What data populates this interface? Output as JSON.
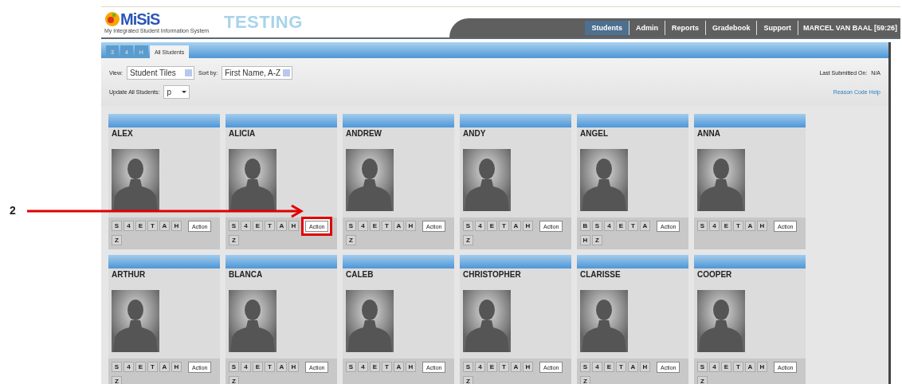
{
  "header": {
    "logo": "MiSiS",
    "logo_caption": "My Integrated Student Information System",
    "environment": "TESTING"
  },
  "nav": [
    {
      "label": "Students",
      "selected": true
    },
    {
      "label": "Admin",
      "selected": false
    },
    {
      "label": "Reports",
      "selected": false
    },
    {
      "label": "Gradebook",
      "selected": false
    },
    {
      "label": "Support",
      "selected": false
    }
  ],
  "user": "MARCEL VAN BAAL [59:26]",
  "tabs": [
    {
      "label": "3",
      "selected": false
    },
    {
      "label": "4",
      "selected": false
    },
    {
      "label": "H",
      "selected": false
    },
    {
      "label": "All Students",
      "selected": true
    }
  ],
  "filters": {
    "view_label": "View:",
    "view_value": "Student Tiles",
    "sort_label": "Sort by:",
    "sort_value": "First Name, A-Z",
    "update_label": "Update All Students:",
    "update_value": "p",
    "last_submitted_label": "Last Submitted On:",
    "last_submitted_value": "N/A",
    "help_link": "Reason Code Help"
  },
  "cards": [
    {
      "name": "ALEX",
      "codes": [
        "S",
        "4",
        "E",
        "T",
        "A",
        "H",
        "Z"
      ],
      "action": "Action",
      "highlighted": false
    },
    {
      "name": "ALICIA",
      "codes": [
        "S",
        "4",
        "E",
        "T",
        "A",
        "H",
        "Z"
      ],
      "action": "Action",
      "highlighted": true
    },
    {
      "name": "ANDREW",
      "codes": [
        "S",
        "4",
        "E",
        "T",
        "A",
        "H",
        "Z"
      ],
      "action": "Action",
      "highlighted": false
    },
    {
      "name": "ANDY",
      "codes": [
        "S",
        "4",
        "E",
        "T",
        "A",
        "H",
        "Z"
      ],
      "action": "Action",
      "highlighted": false
    },
    {
      "name": "ANGEL",
      "codes": [
        "B",
        "S",
        "4",
        "E",
        "T",
        "A",
        "H",
        "Z"
      ],
      "action": "Action",
      "highlighted": false
    },
    {
      "name": "ANNA",
      "codes": [
        "S",
        "4",
        "E",
        "T",
        "A",
        "H"
      ],
      "action": "Action",
      "highlighted": false
    },
    {
      "name": "ARTHUR",
      "codes": [
        "S",
        "4",
        "E",
        "T",
        "A",
        "H",
        "Z"
      ],
      "action": "Action",
      "highlighted": false
    },
    {
      "name": "BLANCA",
      "codes": [
        "S",
        "4",
        "E",
        "T",
        "A",
        "H",
        "Z"
      ],
      "action": "Action",
      "highlighted": false
    },
    {
      "name": "CALEB",
      "codes": [
        "S",
        "4",
        "E",
        "T",
        "A",
        "H"
      ],
      "action": "Action",
      "highlighted": false
    },
    {
      "name": "CHRISTOPHER",
      "codes": [
        "S",
        "4",
        "E",
        "T",
        "A",
        "H",
        "Z"
      ],
      "action": "Action",
      "highlighted": false
    },
    {
      "name": "CLARISSE",
      "codes": [
        "S",
        "4",
        "E",
        "T",
        "A",
        "H",
        "Z"
      ],
      "action": "Action",
      "highlighted": false
    },
    {
      "name": "COOPER",
      "codes": [
        "S",
        "4",
        "E",
        "T",
        "A",
        "H",
        "Z"
      ],
      "action": "Action",
      "highlighted": false
    }
  ],
  "annotation": {
    "label": "2"
  }
}
